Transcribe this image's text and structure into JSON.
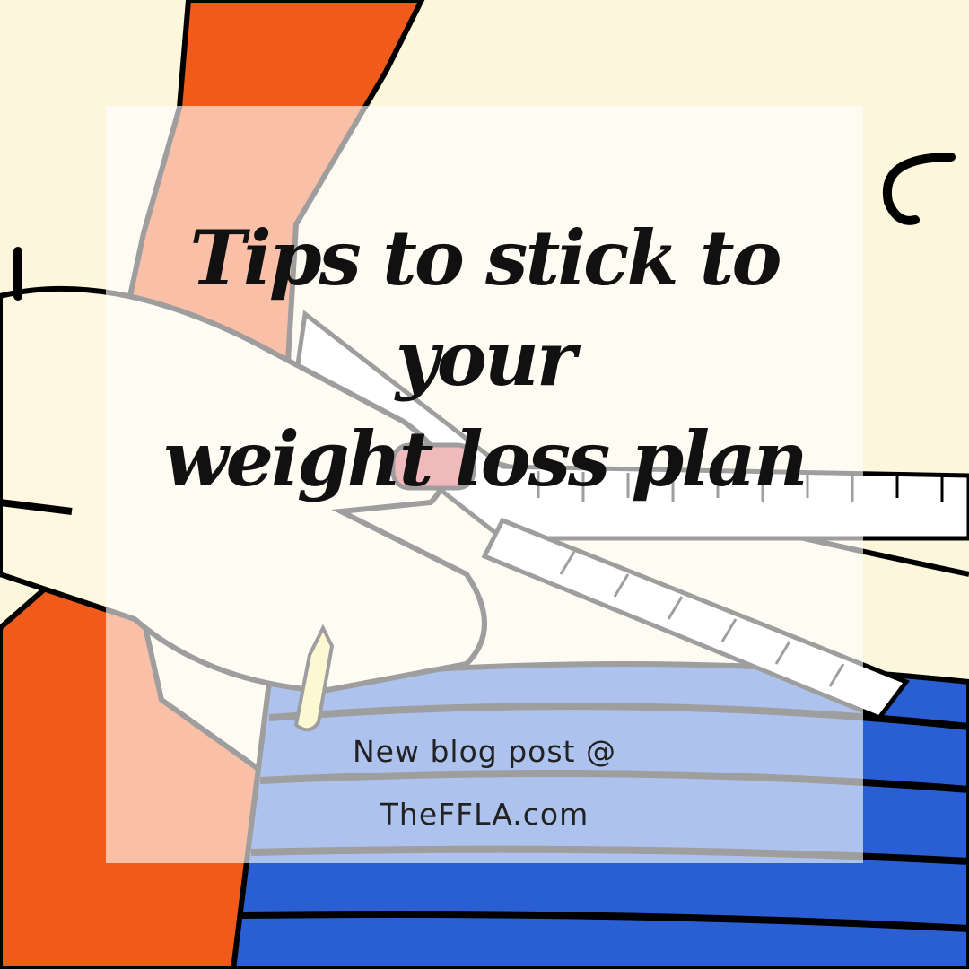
{
  "headline": {
    "line1": "Tips to stick to your",
    "line2": "weight loss plan"
  },
  "footer": {
    "line1": "New blog post @",
    "line2": "TheFFLA.com"
  },
  "colors": {
    "background": "#fbf6dc",
    "orange": "#f05a1a",
    "salmon": "#f5a985",
    "blue": "#2a5fd3",
    "light_blue": "#8fb2f2",
    "text": "#111111"
  },
  "illustration": "cartoon hands wrapping a measuring tape around a waist"
}
